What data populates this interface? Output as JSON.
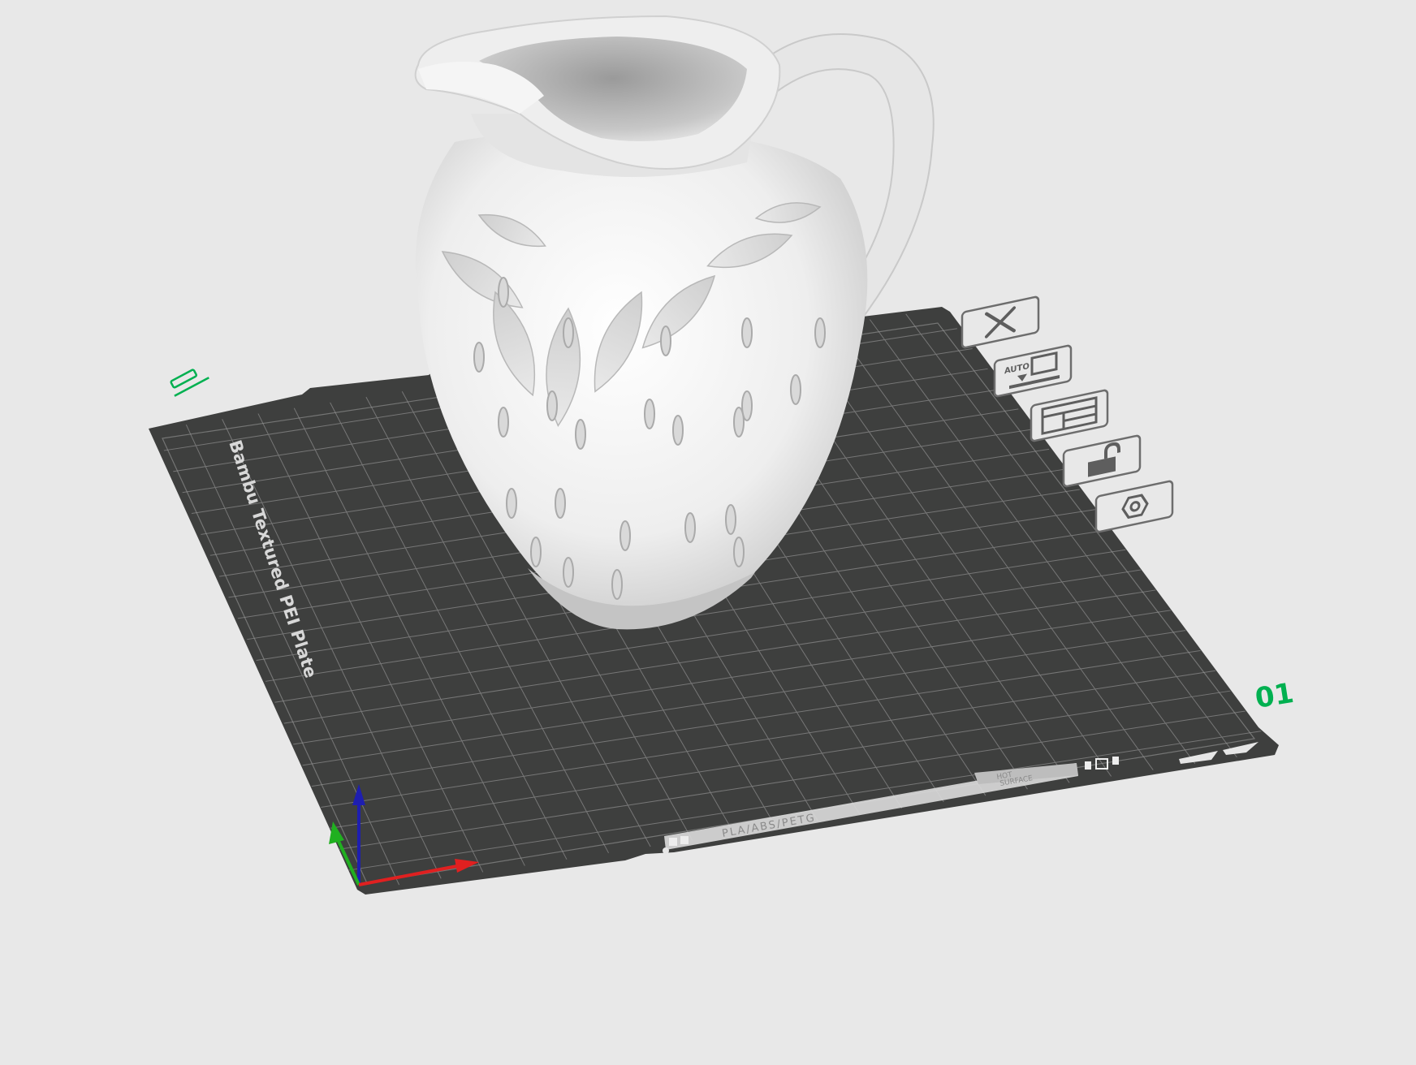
{
  "viewport": {
    "background": "#e8e8e8",
    "plate_color": "#3e3f3e",
    "grid_color": "#8a8a8a",
    "accent_green": "#00b050"
  },
  "plate": {
    "name_label": "Bambu Textured PEI Plate",
    "number_label": "01",
    "material_label": "PLA/ABS/PETG",
    "hot_label_line1": "HOT",
    "hot_label_line2": "SURFACE",
    "edit_name_icon": "pencil-icon"
  },
  "plate_toolbar": [
    {
      "id": "delete-plate",
      "icon": "close-x-icon"
    },
    {
      "id": "auto-orient",
      "icon": "auto-orient-icon",
      "text": "AUTO"
    },
    {
      "id": "arrange",
      "icon": "arrange-icon"
    },
    {
      "id": "lock-plate",
      "icon": "unlock-icon"
    },
    {
      "id": "plate-settings",
      "icon": "hex-nut-icon"
    }
  ],
  "model": {
    "name": "strawberry pitcher",
    "color": "#f2f2f2"
  },
  "axes": {
    "x_color": "#e02020",
    "y_color": "#20b020",
    "z_color": "#1e1eb0"
  }
}
